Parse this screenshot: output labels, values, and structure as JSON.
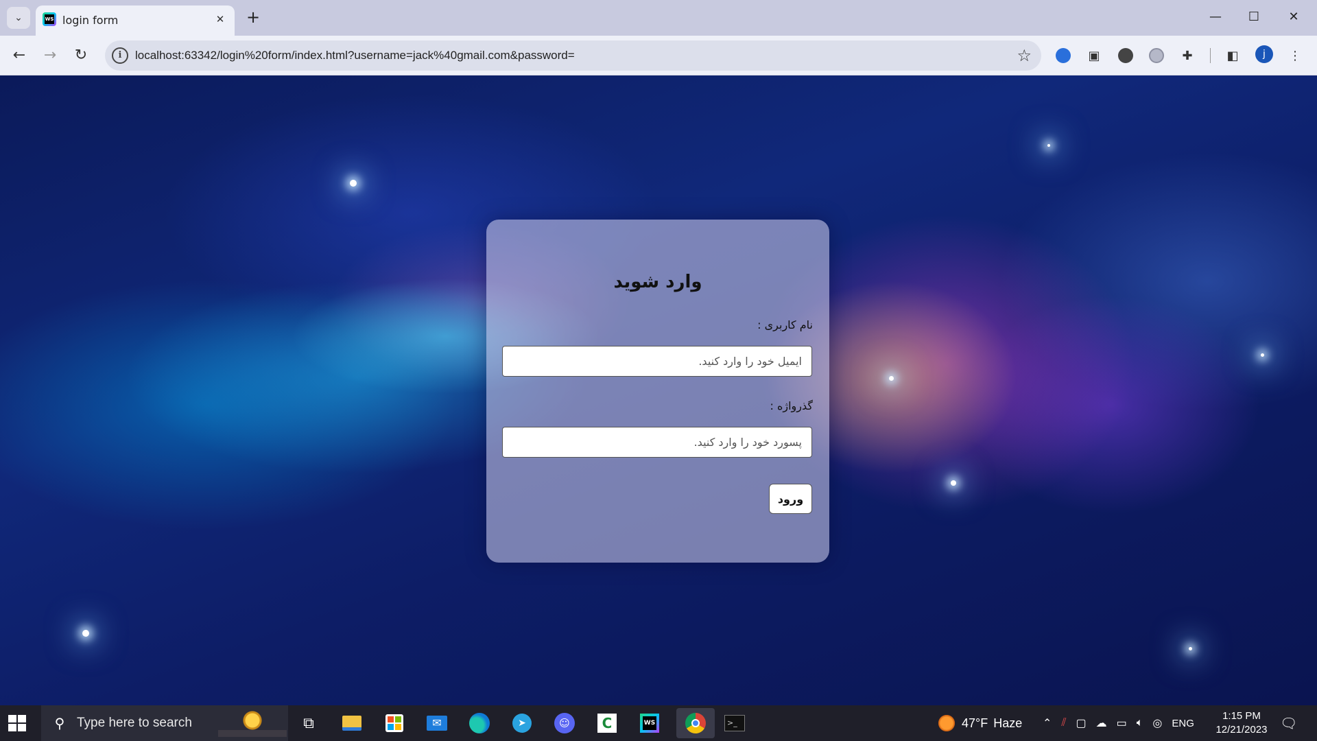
{
  "browser": {
    "tab": {
      "title": "login form",
      "favicon_icon": "webstorm-icon",
      "favicon_text": "WS"
    },
    "url": "localhost:63342/login%20form/index.html?username=jack%40gmail.com&password=",
    "nav": {
      "back_icon": "arrow-left-icon",
      "forward_icon": "arrow-right-icon",
      "reload_icon": "reload-icon"
    },
    "window_controls": [
      "minimize",
      "maximize",
      "close"
    ],
    "profile_initial": "j"
  },
  "login_form": {
    "title": "وارد شوید",
    "username": {
      "label": "نام کاربری :",
      "placeholder": "ایمیل خود را وارد کنید."
    },
    "password": {
      "label": "گذرواژه :",
      "placeholder": "پسورد خود را وارد کنید."
    },
    "submit_label": "ورود"
  },
  "taskbar": {
    "search_placeholder": "Type here to search",
    "weather": {
      "temperature": "47°F",
      "condition": "Haze"
    },
    "language": "ENG",
    "time": "1:15 PM",
    "date": "12/21/2023",
    "pinned_apps": [
      "task-view",
      "file-explorer",
      "microsoft-store",
      "mail",
      "edge",
      "telegram",
      "discord",
      "camtasia",
      "webstorm",
      "chrome",
      "terminal"
    ]
  },
  "colors": {
    "tabbar_bg": "#c8cadf",
    "toolbar_bg": "#eef0f8",
    "taskbar_bg": "#1f1f29",
    "card_bg": "rgba(190,190,225,0.62)"
  }
}
